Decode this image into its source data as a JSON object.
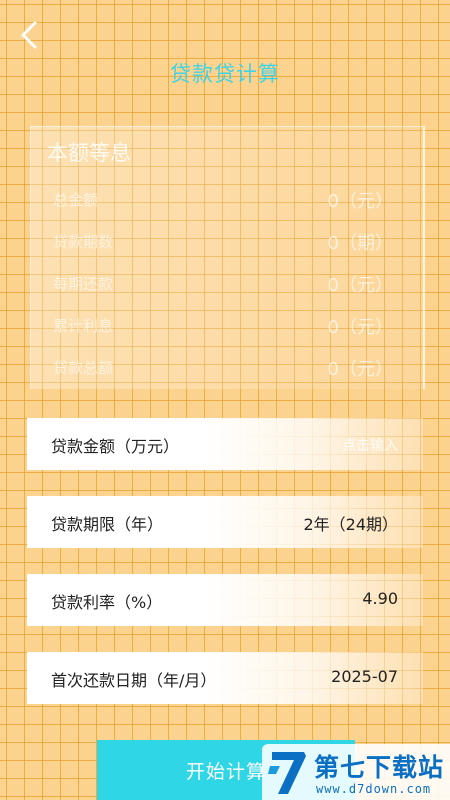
{
  "header": {
    "title": "贷款贷计算"
  },
  "summary": {
    "title": "本额等息",
    "rows": [
      {
        "label": "总金额",
        "value": "0（元）"
      },
      {
        "label": "贷款期数",
        "value": "0（期）"
      },
      {
        "label": "每期还款",
        "value": "0（元）"
      },
      {
        "label": "累计利息",
        "value": "0（元）"
      },
      {
        "label": "贷款总额",
        "value": "0（元）"
      }
    ]
  },
  "form": {
    "amount": {
      "label": "贷款金额（万元）",
      "placeholder": "点击输入"
    },
    "term": {
      "label": "贷款期限（年）",
      "value": "2年（24期）"
    },
    "rate": {
      "label": "贷款利率（%）",
      "value": "4.90"
    },
    "first_date": {
      "label": "首次还款日期（年/月）",
      "value": "2025-07"
    }
  },
  "actions": {
    "start_label": "开始计算"
  },
  "watermark": {
    "name": "第七下载站",
    "url": "www.d7down.com",
    "logo_char": "7"
  },
  "colors": {
    "accent": "#3fd3e6",
    "button": "#2fd6e6",
    "background": "#fcd28f",
    "grid": "#e9a028",
    "watermark": "#0b6fc4"
  },
  "icons": {
    "back": "chevron-left-icon",
    "watermark_logo": "d7-logo-icon"
  }
}
